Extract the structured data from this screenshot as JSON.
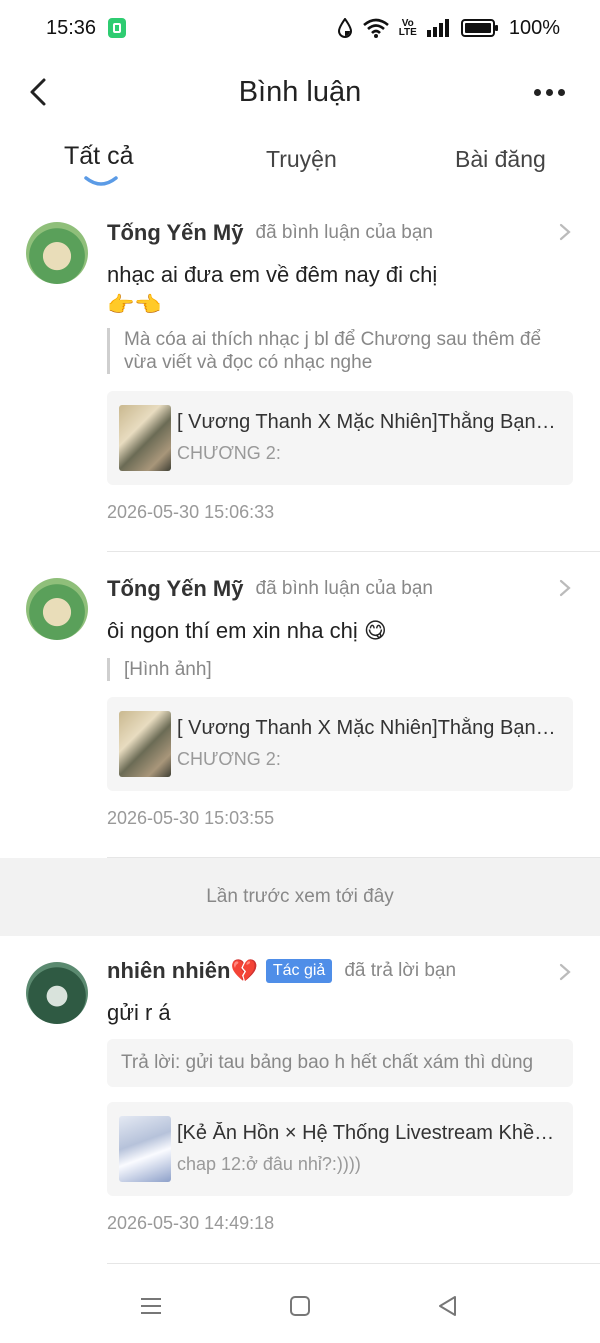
{
  "status_bar": {
    "time": "15:36",
    "volte_top": "Vo",
    "volte_bottom": "LTE",
    "battery": "100%"
  },
  "header": {
    "title": "Bình luận"
  },
  "tabs": [
    {
      "label": "Tất cả",
      "active": true
    },
    {
      "label": "Truyện",
      "active": false
    },
    {
      "label": "Bài đăng",
      "active": false
    }
  ],
  "comments": [
    {
      "user": "Tống Yến Mỹ",
      "action": "đã bình luận của bạn",
      "text": "nhạc ai đưa em về đêm nay đi chị",
      "emoji": "👉👈",
      "quote": "Mà cóa ai thích nhạc j bl để Chương sau thêm để vừa viết và đọc có nhạc nghe",
      "story_title": "[ Vương Thanh X Mặc Nhiên]Thằng Bạn C...",
      "story_sub": "CHƯƠNG 2:",
      "time": "2026-05-30 15:06:33"
    },
    {
      "user": "Tống Yến Mỹ",
      "action": "đã bình luận của bạn",
      "text": "ôi ngon thí em xin nha chị 😋",
      "quote": "[Hình ảnh]",
      "story_title": "[ Vương Thanh X Mặc Nhiên]Thằng Bạn C...",
      "story_sub": "CHƯƠNG 2:",
      "time": "2026-05-30 15:03:55"
    },
    {
      "user": "nhiên nhiên💔",
      "badge": "Tác giả",
      "action": "đã trả lời bạn",
      "text": "gửi r á",
      "reply": "Trả lời: gửi tau bảng bao h hết chất xám thì dùng",
      "story_title": "[Kẻ Ăn Hồn × Hệ Thống Livestream Khều ...",
      "story_sub": "chap 12:ở đâu nhỉ?:))))",
      "time": "2026-05-30 14:49:18"
    }
  ],
  "last_seen_label": "Lần trước xem tới đây",
  "colors": {
    "accent_underline": "#5b9be6",
    "author_badge": "#4f8ee8",
    "divider": "#e6e6e6"
  }
}
